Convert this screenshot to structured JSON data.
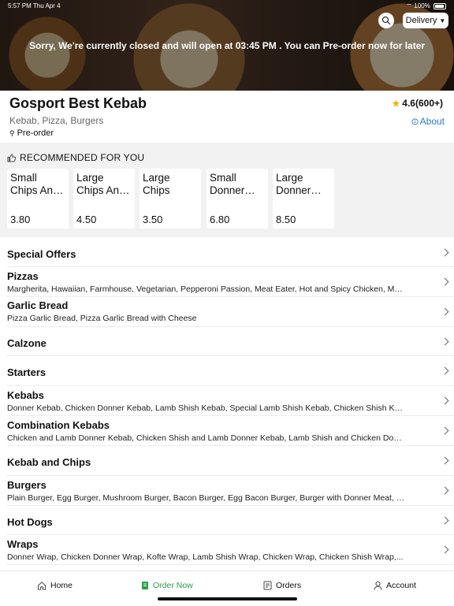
{
  "status_bar": {
    "time": "5:57 PM  Thu Apr 4",
    "battery": "100%"
  },
  "header": {
    "delivery_label": "Delivery",
    "closed_message": "Sorry, We're currently closed and will open at 03:45 PM . You can Pre-order now for later"
  },
  "restaurant": {
    "name": "Gosport Best Kebab",
    "rating": "4.6(600+)",
    "cuisines": "Kebab, Pizza, Burgers",
    "about_label": "About",
    "preorder_label": "Pre-order"
  },
  "recommended": {
    "title": "RECOMMENDED FOR YOU",
    "items": [
      {
        "name": "Small Chips And Cheese",
        "price": "3.80"
      },
      {
        "name": "Large Chips And Cheese",
        "price": "4.50"
      },
      {
        "name": "Large Chips",
        "price": "3.50"
      },
      {
        "name": "Small Donner Kebab",
        "price": "6.80"
      },
      {
        "name": "Large Donner Kebab",
        "price": "8.50"
      }
    ]
  },
  "categories": [
    {
      "title": "Special Offers",
      "items": ""
    },
    {
      "title": "Pizzas",
      "items": "Margherita, Hawaiian, Farmhouse, Vegetarian, Pepperoni Passion, Meat Eater, Hot and Spicy Chicken, Mexi..."
    },
    {
      "title": "Garlic Bread",
      "items": "Pizza Garlic Bread, Pizza Garlic Bread with Cheese"
    },
    {
      "title": "Calzone",
      "items": ""
    },
    {
      "title": "Starters",
      "items": ""
    },
    {
      "title": "Kebabs",
      "items": "Donner Kebab, Chicken Donner Kebab, Lamb Shish Kebab, Special Lamb Shish Kebab, Chicken Shish Kebab..."
    },
    {
      "title": "Combination Kebabs",
      "items": "Chicken and Lamb Donner Kebab, Chicken Shish and Lamb Donner Kebab, Lamb Shish and Chicken Donner..."
    },
    {
      "title": "Kebab and Chips",
      "items": ""
    },
    {
      "title": "Burgers",
      "items": "Plain Burger, Egg Burger, Mushroom Burger, Bacon Burger, Egg Bacon Burger, Burger with Donner Meat, M..."
    },
    {
      "title": "Hot Dogs",
      "items": ""
    },
    {
      "title": "Wraps",
      "items": "Donner Wrap, Chicken Donner Wrap, Kofte Wrap, Lamb Shish Wrap, Chicken Wrap, Chicken Shish Wrap,..."
    }
  ],
  "tabbar": {
    "home": "Home",
    "order_now": "Order Now",
    "orders": "Orders",
    "account": "Account"
  },
  "colors": {
    "accent_green": "#27a048",
    "link_blue": "#2a7ad5",
    "star": "#f0b400"
  }
}
